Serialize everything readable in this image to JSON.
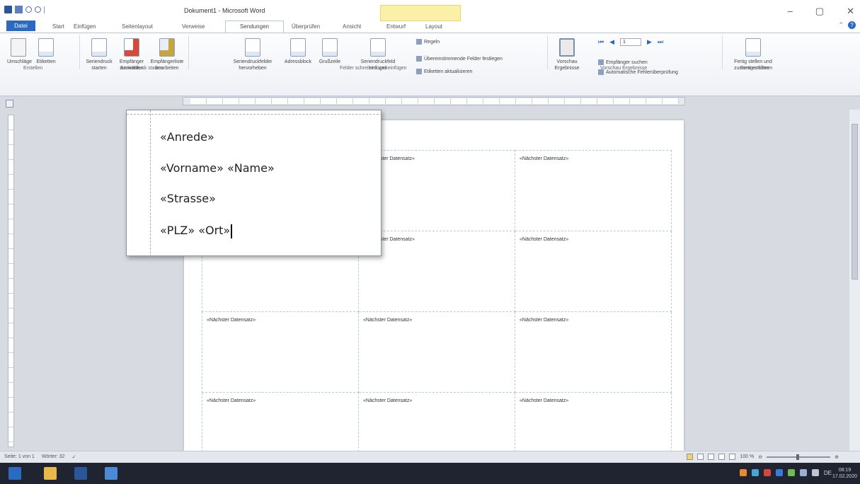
{
  "window": {
    "title": "Dokument1 - Microsoft Word",
    "minimize": "–",
    "restore": "▢",
    "close": "✕"
  },
  "tabs": [
    {
      "label": "Datei"
    },
    {
      "label": "Start"
    },
    {
      "label": "Einfügen"
    },
    {
      "label": "Seitenlayout"
    },
    {
      "label": "Verweise"
    },
    {
      "label": "Sendungen"
    },
    {
      "label": "Überprüfen"
    },
    {
      "label": "Ansicht"
    },
    {
      "label": "Entwurf"
    },
    {
      "label": "Layout"
    }
  ],
  "ribbon": {
    "envelopes": "Umschläge",
    "labels": "Etiketten",
    "group_create": "Erstellen",
    "start_merge": "Seriendruck starten",
    "select_recipients": "Empfänger auswählen",
    "edit_recipients": "Empfängerliste bearbeiten",
    "group_start": "Seriendruck starten",
    "highlight_fields": "Seriendruckfelder hervorheben",
    "address_block": "Adressblock",
    "greeting_line": "Grußzeile",
    "insert_field": "Seriendruckfeld einfügen",
    "rules": "Regeln",
    "match_fields": "Übereinstimmende Felder festlegen",
    "update_labels": "Etiketten aktualisieren",
    "group_fields": "Felder schreiben und einfügen",
    "preview": "Vorschau Ergebnisse",
    "record_number": "1",
    "find_recipient": "Empfänger suchen",
    "auto_check": "Automatische Fehlerüberprüfung",
    "group_preview": "Vorschau Ergebnisse",
    "finish": "Fertig stellen und zusammenführen",
    "group_finish": "Fertig stellen"
  },
  "zoom_popup": {
    "line1": "«Anrede»",
    "line2": "«Vorname» «Name»",
    "line3": "«Strasse»",
    "line4": "«PLZ» «Ort»"
  },
  "labels": {
    "next_record": "«Nächster Datensatz»",
    "partial": "hster Datensatz»"
  },
  "status": {
    "page": "Seite: 1 von 1",
    "words": "Wörter: 32",
    "zoom": "100 %"
  },
  "taskbar": {
    "lang": "DE",
    "time": "08:19",
    "date": "17.02.2020"
  }
}
